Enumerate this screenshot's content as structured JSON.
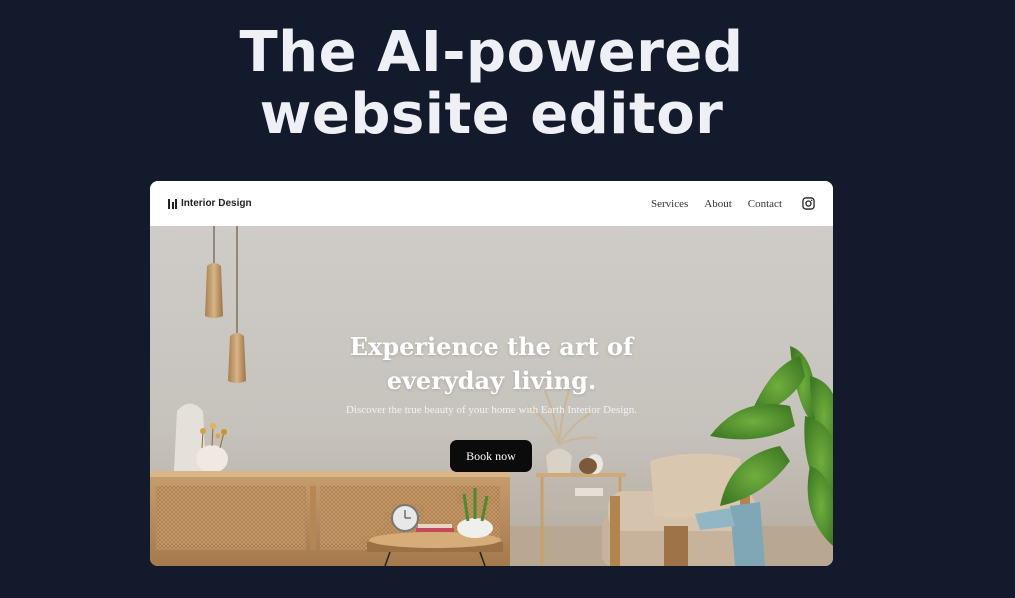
{
  "headline": {
    "line1": "The AI-powered",
    "line2": "website editor"
  },
  "site": {
    "brand": "Interior Design",
    "nav": {
      "services": "Services",
      "about": "About",
      "contact": "Contact",
      "social_icon": "instagram-icon"
    },
    "hero": {
      "title_line1": "Experience the art of",
      "title_line2": "everyday living.",
      "subtitle": "Discover the true beauty of your home with Earth Interior Design.",
      "cta": "Book now"
    }
  },
  "colors": {
    "page_background": "#121a2b",
    "headline": "#eef0f6",
    "cta_background": "#0b0b0b"
  }
}
